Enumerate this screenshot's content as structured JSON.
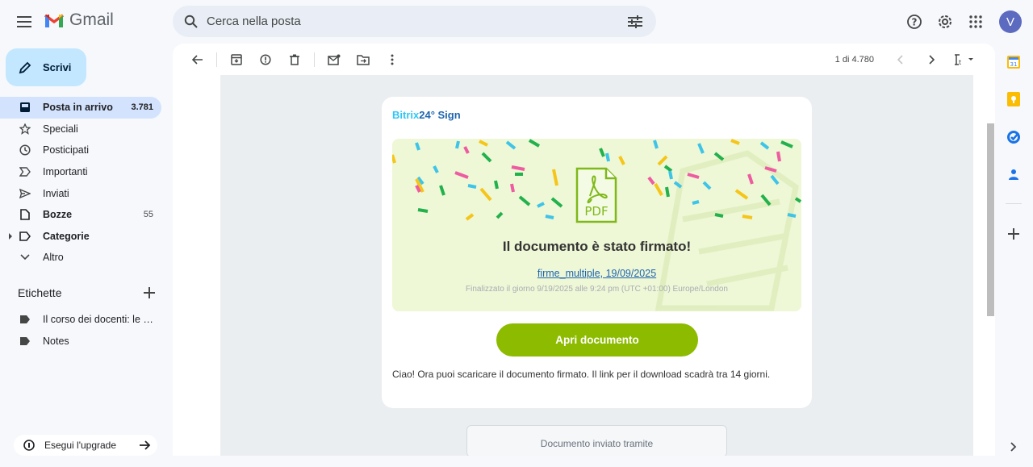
{
  "app": {
    "name": "Gmail"
  },
  "search": {
    "placeholder": "Cerca nella posta"
  },
  "user": {
    "avatar_letter": "V",
    "avatar_color": "#5c6bc0"
  },
  "compose": {
    "label": "Scrivi"
  },
  "nav": {
    "items": [
      {
        "label": "Posta in arrivo",
        "count": "3.781",
        "icon": "inbox-icon"
      },
      {
        "label": "Speciali",
        "count": "",
        "icon": "star-icon"
      },
      {
        "label": "Posticipati",
        "count": "",
        "icon": "clock-icon"
      },
      {
        "label": "Importanti",
        "count": "",
        "icon": "important-icon"
      },
      {
        "label": "Inviati",
        "count": "",
        "icon": "send-icon"
      },
      {
        "label": "Bozze",
        "count": "55",
        "icon": "draft-icon"
      },
      {
        "label": "Categorie",
        "count": "",
        "icon": "label-outline-icon"
      },
      {
        "label": "Altro",
        "count": "",
        "icon": "chevron-down-icon"
      }
    ]
  },
  "labels": {
    "heading": "Etichette",
    "items": [
      {
        "label": "Il corso dei docenti: le le..."
      },
      {
        "label": "Notes"
      }
    ]
  },
  "upgrade": {
    "label": "Esegui l'upgrade"
  },
  "toolbar": {
    "pager": "1 di 4.780"
  },
  "email": {
    "brand": {
      "part1": "Bitrix",
      "part2": "24",
      "part3": "Sign"
    },
    "title": "Il documento è stato firmato!",
    "doc_link": "firme_multiple, 19/09/2025",
    "finalized": "Finalizzato il giorno 9/19/2025 alle 9:24 pm (UTC +01:00) Europe/London",
    "button": "Apri documento",
    "body": "Ciao! Ora puoi scaricare il documento firmato. Il link per il download scadrà tra 14 giorni.",
    "footer": "Documento inviato tramite",
    "pdf_label": "PDF",
    "accent_green": "#8dbb00",
    "brand_blue": "#2fc6f6"
  }
}
